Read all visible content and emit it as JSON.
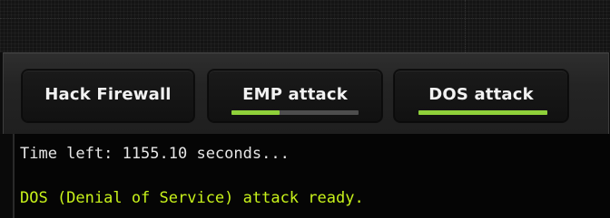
{
  "buttons": {
    "hack_firewall": {
      "label": "Hack Firewall"
    },
    "emp_attack": {
      "label": "EMP attack",
      "progress": 0.38
    },
    "dos_attack": {
      "label": "DOS attack",
      "progress": 1.0
    }
  },
  "console": {
    "timer_text": "Time left: 1155.10 seconds...",
    "status_text": "DOS (Denial of Service) attack ready."
  },
  "colors": {
    "progress_fill": "#8fd13a",
    "progress_track": "#4d4d4d",
    "status_text": "#c8f21a",
    "console_text": "#e6e6e6"
  }
}
